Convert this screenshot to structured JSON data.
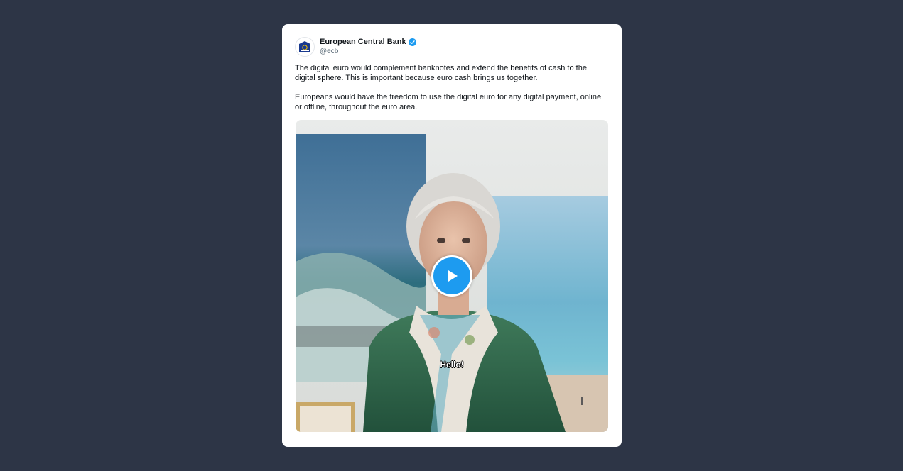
{
  "tweet": {
    "author": {
      "name": "European Central Bank",
      "handle": "@ecb",
      "verified": true,
      "avatar_icon": "ecb-logo-icon"
    },
    "paragraphs": [
      "The digital euro would complement banknotes and extend the benefits of cash to the digital sphere. This is important because euro cash brings us together.",
      "Europeans would have the freedom to use the digital euro for any digital payment, online or offline, throughout the euro area."
    ],
    "video": {
      "caption": "Hello!",
      "play_icon": "play-icon"
    }
  },
  "colors": {
    "background": "#2d3546",
    "card": "#ffffff",
    "accent": "#1d9bf0",
    "text": "#0f1419",
    "muted": "#536471"
  }
}
